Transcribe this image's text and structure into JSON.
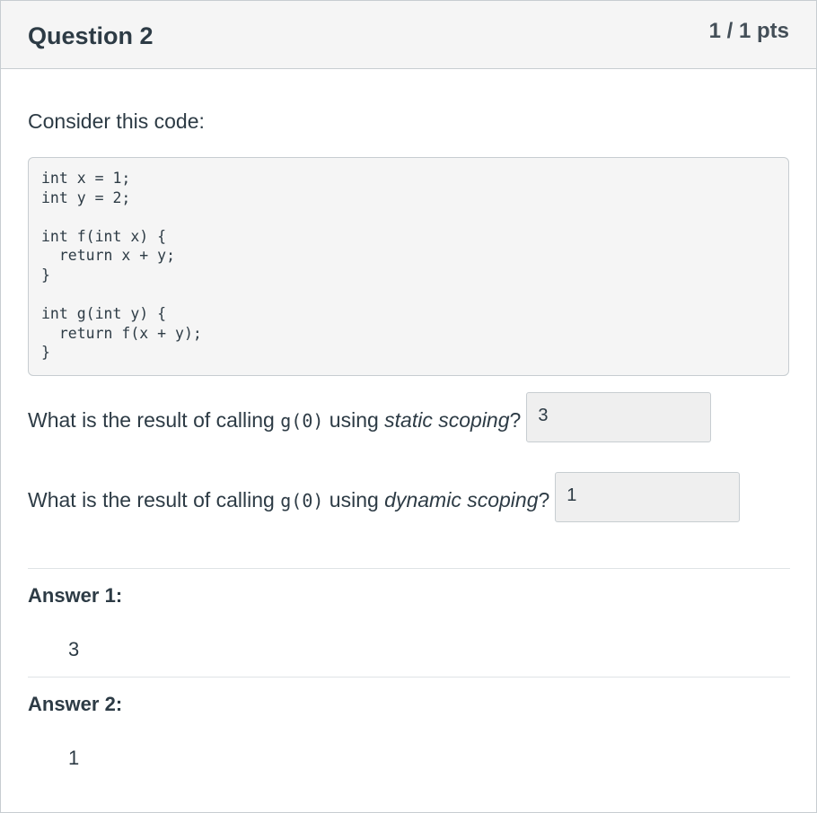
{
  "question": {
    "title": "Question 2",
    "points": "1 / 1 pts",
    "intro": "Consider this code:",
    "code": "int x = 1;\nint y = 2;\n\nint f(int x) {\n  return x + y;\n}\n\nint g(int y) {\n  return f(x + y);\n}"
  },
  "prompts": [
    {
      "prefix": "What is the result of calling ",
      "code": "g(0)",
      "middle": " using ",
      "emphasis": "static scoping",
      "suffix": "?",
      "answer": "3"
    },
    {
      "prefix": "What is the result of calling ",
      "code": "g(0)",
      "middle": " using ",
      "emphasis": "dynamic scoping",
      "suffix": "?",
      "answer": "1"
    }
  ],
  "answers": [
    {
      "label": "Answer 1:",
      "value": "3"
    },
    {
      "label": "Answer 2:",
      "value": "1"
    }
  ]
}
